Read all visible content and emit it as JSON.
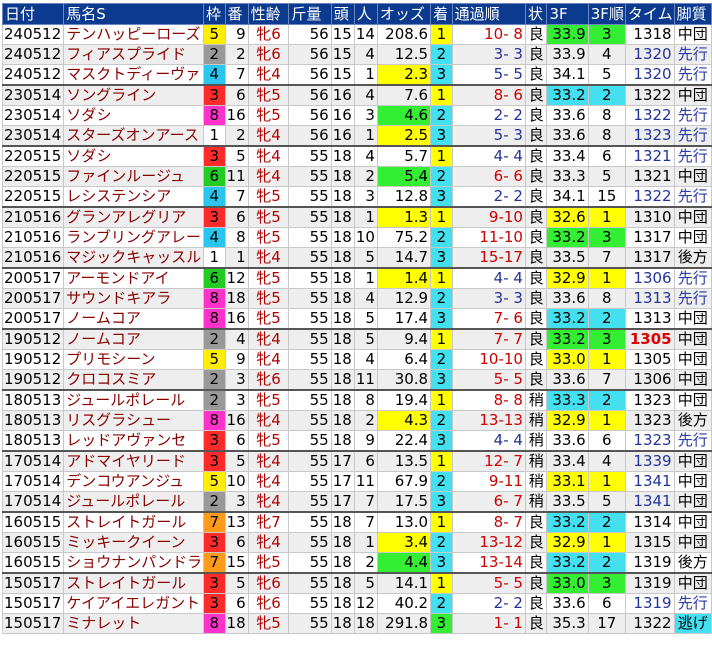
{
  "headers": [
    "日付",
    "馬名S",
    "枠",
    "番",
    "性齢",
    "斤量",
    "頭",
    "人",
    "オッズ",
    "着",
    "通過順",
    "状",
    "3F",
    "3F順",
    "タイム",
    "脚質"
  ],
  "rows": [
    {
      "date": "240512",
      "name": "テンハッピーローズ",
      "waku": "5",
      "ban": "9",
      "sexage": "牝6",
      "kin": "56",
      "tou": "15",
      "nin": "14",
      "odds": "208.6",
      "odds_hl": "",
      "chaku": "1",
      "chaku_hl": "yellow",
      "pass": "10- 8",
      "pass_color": "red",
      "cond": "良",
      "f3": "33.9",
      "f3_hl": "green",
      "f3r": "3",
      "f3r_hl": "green",
      "time": "1318",
      "time_style": "",
      "style": "中団",
      "style_hl": "",
      "sep": false
    },
    {
      "date": "240512",
      "name": "フィアスプライド",
      "waku": "2",
      "ban": "2",
      "sexage": "牝6",
      "kin": "56",
      "tou": "15",
      "nin": "4",
      "odds": "12.5",
      "odds_hl": "",
      "chaku": "2",
      "chaku_hl": "cyan",
      "pass": "3- 3",
      "pass_color": "blue",
      "cond": "良",
      "f3": "33.9",
      "f3_hl": "",
      "f3r": "4",
      "f3r_hl": "",
      "time": "1320",
      "time_style": "",
      "style": "先行",
      "style_hl": "lead",
      "sep": false
    },
    {
      "date": "240512",
      "name": "マスクトディーヴァ",
      "waku": "4",
      "ban": "7",
      "sexage": "牝4",
      "kin": "56",
      "tou": "15",
      "nin": "1",
      "odds": "2.3",
      "odds_hl": "yellow",
      "chaku": "3",
      "chaku_hl": "cyan",
      "pass": "5- 5",
      "pass_color": "blue",
      "cond": "良",
      "f3": "34.1",
      "f3_hl": "",
      "f3r": "5",
      "f3r_hl": "",
      "time": "1320",
      "time_style": "",
      "style": "先行",
      "style_hl": "lead",
      "sep": false
    },
    {
      "date": "230514",
      "name": "ソングライン",
      "waku": "3",
      "ban": "6",
      "sexage": "牝5",
      "kin": "56",
      "tou": "16",
      "nin": "4",
      "odds": "7.6",
      "odds_hl": "",
      "chaku": "1",
      "chaku_hl": "yellow",
      "pass": "8- 6",
      "pass_color": "red",
      "cond": "良",
      "f3": "33.2",
      "f3_hl": "cyan",
      "f3r": "2",
      "f3r_hl": "cyan",
      "time": "1322",
      "time_style": "",
      "style": "中団",
      "style_hl": "",
      "sep": true
    },
    {
      "date": "230514",
      "name": "ソダシ",
      "waku": "8",
      "ban": "16",
      "sexage": "牝5",
      "kin": "56",
      "tou": "16",
      "nin": "3",
      "odds": "4.6",
      "odds_hl": "green",
      "chaku": "2",
      "chaku_hl": "cyan",
      "pass": "2- 2",
      "pass_color": "blue",
      "cond": "良",
      "f3": "33.6",
      "f3_hl": "",
      "f3r": "8",
      "f3r_hl": "",
      "time": "1322",
      "time_style": "",
      "style": "先行",
      "style_hl": "lead",
      "sep": false
    },
    {
      "date": "230514",
      "name": "スターズオンアース",
      "waku": "1",
      "ban": "2",
      "sexage": "牝4",
      "kin": "56",
      "tou": "16",
      "nin": "1",
      "odds": "2.5",
      "odds_hl": "yellow",
      "chaku": "3",
      "chaku_hl": "cyan",
      "pass": "5- 3",
      "pass_color": "blue",
      "cond": "良",
      "f3": "33.6",
      "f3_hl": "",
      "f3r": "8",
      "f3r_hl": "",
      "time": "1323",
      "time_style": "",
      "style": "先行",
      "style_hl": "lead",
      "sep": false
    },
    {
      "date": "220515",
      "name": "ソダシ",
      "waku": "3",
      "ban": "5",
      "sexage": "牝4",
      "kin": "55",
      "tou": "18",
      "nin": "4",
      "odds": "5.7",
      "odds_hl": "",
      "chaku": "1",
      "chaku_hl": "yellow",
      "pass": "4- 4",
      "pass_color": "blue",
      "cond": "良",
      "f3": "33.4",
      "f3_hl": "",
      "f3r": "6",
      "f3r_hl": "",
      "time": "1321",
      "time_style": "",
      "style": "先行",
      "style_hl": "lead",
      "sep": true
    },
    {
      "date": "220515",
      "name": "ファインルージュ",
      "waku": "6",
      "ban": "11",
      "sexage": "牝4",
      "kin": "55",
      "tou": "18",
      "nin": "2",
      "odds": "5.4",
      "odds_hl": "green",
      "chaku": "2",
      "chaku_hl": "cyan",
      "pass": "6- 6",
      "pass_color": "red",
      "cond": "良",
      "f3": "33.3",
      "f3_hl": "",
      "f3r": "5",
      "f3r_hl": "",
      "time": "1321",
      "time_style": "",
      "style": "中団",
      "style_hl": "",
      "sep": false
    },
    {
      "date": "220515",
      "name": "レシステンシア",
      "waku": "4",
      "ban": "7",
      "sexage": "牝5",
      "kin": "55",
      "tou": "18",
      "nin": "3",
      "odds": "12.8",
      "odds_hl": "",
      "chaku": "3",
      "chaku_hl": "cyan",
      "pass": "2- 2",
      "pass_color": "blue",
      "cond": "良",
      "f3": "34.1",
      "f3_hl": "",
      "f3r": "15",
      "f3r_hl": "",
      "time": "1322",
      "time_style": "",
      "style": "先行",
      "style_hl": "lead",
      "sep": false
    },
    {
      "date": "210516",
      "name": "グランアレグリア",
      "waku": "3",
      "ban": "6",
      "sexage": "牝5",
      "kin": "55",
      "tou": "18",
      "nin": "1",
      "odds": "1.3",
      "odds_hl": "yellow",
      "chaku": "1",
      "chaku_hl": "yellow",
      "pass": "9-10",
      "pass_color": "red",
      "cond": "良",
      "f3": "32.6",
      "f3_hl": "yellow",
      "f3r": "1",
      "f3r_hl": "yellow",
      "time": "1310",
      "time_style": "",
      "style": "中団",
      "style_hl": "",
      "sep": true
    },
    {
      "date": "210516",
      "name": "ランブリングアレー",
      "waku": "4",
      "ban": "8",
      "sexage": "牝5",
      "kin": "55",
      "tou": "18",
      "nin": "10",
      "odds": "75.2",
      "odds_hl": "",
      "chaku": "2",
      "chaku_hl": "cyan",
      "pass": "11-10",
      "pass_color": "red",
      "cond": "良",
      "f3": "33.2",
      "f3_hl": "green",
      "f3r": "3",
      "f3r_hl": "green",
      "time": "1317",
      "time_style": "",
      "style": "中団",
      "style_hl": "",
      "sep": false
    },
    {
      "date": "210516",
      "name": "マジックキャッスル",
      "waku": "1",
      "ban": "1",
      "sexage": "牝4",
      "kin": "55",
      "tou": "18",
      "nin": "5",
      "odds": "14.7",
      "odds_hl": "",
      "chaku": "3",
      "chaku_hl": "cyan",
      "pass": "15-17",
      "pass_color": "red",
      "cond": "良",
      "f3": "33.5",
      "f3_hl": "",
      "f3r": "7",
      "f3r_hl": "",
      "time": "1317",
      "time_style": "",
      "style": "後方",
      "style_hl": "",
      "sep": false
    },
    {
      "date": "200517",
      "name": "アーモンドアイ",
      "waku": "6",
      "ban": "12",
      "sexage": "牝5",
      "kin": "55",
      "tou": "18",
      "nin": "1",
      "odds": "1.4",
      "odds_hl": "yellow",
      "chaku": "1",
      "chaku_hl": "yellow",
      "pass": "4- 4",
      "pass_color": "blue",
      "cond": "良",
      "f3": "32.9",
      "f3_hl": "yellow",
      "f3r": "1",
      "f3r_hl": "yellow",
      "time": "1306",
      "time_style": "",
      "style": "先行",
      "style_hl": "lead",
      "sep": true
    },
    {
      "date": "200517",
      "name": "サウンドキアラ",
      "waku": "8",
      "ban": "18",
      "sexage": "牝5",
      "kin": "55",
      "tou": "18",
      "nin": "4",
      "odds": "12.9",
      "odds_hl": "",
      "chaku": "2",
      "chaku_hl": "cyan",
      "pass": "3- 3",
      "pass_color": "blue",
      "cond": "良",
      "f3": "33.6",
      "f3_hl": "",
      "f3r": "8",
      "f3r_hl": "",
      "time": "1313",
      "time_style": "",
      "style": "先行",
      "style_hl": "lead",
      "sep": false
    },
    {
      "date": "200517",
      "name": "ノームコア",
      "waku": "8",
      "ban": "16",
      "sexage": "牝5",
      "kin": "55",
      "tou": "18",
      "nin": "5",
      "odds": "17.4",
      "odds_hl": "",
      "chaku": "3",
      "chaku_hl": "cyan",
      "pass": "7- 6",
      "pass_color": "red",
      "cond": "良",
      "f3": "33.2",
      "f3_hl": "cyan",
      "f3r": "2",
      "f3r_hl": "cyan",
      "time": "1313",
      "time_style": "",
      "style": "中団",
      "style_hl": "",
      "sep": false
    },
    {
      "date": "190512",
      "name": "ノームコア",
      "waku": "2",
      "ban": "4",
      "sexage": "牝4",
      "kin": "55",
      "tou": "18",
      "nin": "5",
      "odds": "9.4",
      "odds_hl": "",
      "chaku": "1",
      "chaku_hl": "yellow",
      "pass": "7- 7",
      "pass_color": "red",
      "cond": "良",
      "f3": "33.2",
      "f3_hl": "green",
      "f3r": "3",
      "f3r_hl": "green",
      "time": "1305",
      "time_style": "bold-red",
      "style": "中団",
      "style_hl": "",
      "sep": true
    },
    {
      "date": "190512",
      "name": "プリモシーン",
      "waku": "5",
      "ban": "9",
      "sexage": "牝4",
      "kin": "55",
      "tou": "18",
      "nin": "4",
      "odds": "6.4",
      "odds_hl": "",
      "chaku": "2",
      "chaku_hl": "cyan",
      "pass": "10-10",
      "pass_color": "red",
      "cond": "良",
      "f3": "33.0",
      "f3_hl": "yellow",
      "f3r": "1",
      "f3r_hl": "yellow",
      "time": "1305",
      "time_style": "",
      "style": "中団",
      "style_hl": "",
      "sep": false
    },
    {
      "date": "190512",
      "name": "クロコスミア",
      "waku": "2",
      "ban": "3",
      "sexage": "牝6",
      "kin": "55",
      "tou": "18",
      "nin": "11",
      "odds": "30.8",
      "odds_hl": "",
      "chaku": "3",
      "chaku_hl": "cyan",
      "pass": "5- 5",
      "pass_color": "red",
      "cond": "良",
      "f3": "33.6",
      "f3_hl": "",
      "f3r": "7",
      "f3r_hl": "",
      "time": "1306",
      "time_style": "",
      "style": "中団",
      "style_hl": "",
      "sep": false
    },
    {
      "date": "180513",
      "name": "ジュールポレール",
      "waku": "2",
      "ban": "3",
      "sexage": "牝5",
      "kin": "55",
      "tou": "18",
      "nin": "8",
      "odds": "19.4",
      "odds_hl": "",
      "chaku": "1",
      "chaku_hl": "yellow",
      "pass": "8- 8",
      "pass_color": "red",
      "cond": "稍",
      "f3": "33.3",
      "f3_hl": "cyan",
      "f3r": "2",
      "f3r_hl": "cyan",
      "time": "1323",
      "time_style": "",
      "style": "中団",
      "style_hl": "",
      "sep": true
    },
    {
      "date": "180513",
      "name": "リスグラシュー",
      "waku": "8",
      "ban": "16",
      "sexage": "牝4",
      "kin": "55",
      "tou": "18",
      "nin": "2",
      "odds": "4.3",
      "odds_hl": "yellow",
      "chaku": "2",
      "chaku_hl": "cyan",
      "pass": "13-13",
      "pass_color": "red",
      "cond": "稍",
      "f3": "32.9",
      "f3_hl": "yellow",
      "f3r": "1",
      "f3r_hl": "yellow",
      "time": "1323",
      "time_style": "",
      "style": "後方",
      "style_hl": "",
      "sep": false
    },
    {
      "date": "180513",
      "name": "レッドアヴァンセ",
      "waku": "3",
      "ban": "6",
      "sexage": "牝5",
      "kin": "55",
      "tou": "18",
      "nin": "9",
      "odds": "22.4",
      "odds_hl": "",
      "chaku": "3",
      "chaku_hl": "cyan",
      "pass": "4- 4",
      "pass_color": "blue",
      "cond": "稍",
      "f3": "33.6",
      "f3_hl": "",
      "f3r": "6",
      "f3r_hl": "",
      "time": "1323",
      "time_style": "",
      "style": "先行",
      "style_hl": "lead",
      "sep": false
    },
    {
      "date": "170514",
      "name": "アドマイヤリード",
      "waku": "3",
      "ban": "5",
      "sexage": "牝4",
      "kin": "55",
      "tou": "17",
      "nin": "6",
      "odds": "13.5",
      "odds_hl": "",
      "chaku": "1",
      "chaku_hl": "yellow",
      "pass": "12- 7",
      "pass_color": "red",
      "cond": "稍",
      "f3": "33.4",
      "f3_hl": "",
      "f3r": "4",
      "f3r_hl": "",
      "time": "1339",
      "time_style": "",
      "style": "中団",
      "style_hl": "",
      "sep": true
    },
    {
      "date": "170514",
      "name": "デンコウアンジュ",
      "waku": "5",
      "ban": "10",
      "sexage": "牝4",
      "kin": "55",
      "tou": "17",
      "nin": "11",
      "odds": "67.9",
      "odds_hl": "",
      "chaku": "2",
      "chaku_hl": "cyan",
      "pass": "9-11",
      "pass_color": "red",
      "cond": "稍",
      "f3": "33.1",
      "f3_hl": "yellow",
      "f3r": "1",
      "f3r_hl": "yellow",
      "time": "1341",
      "time_style": "",
      "style": "中団",
      "style_hl": "",
      "sep": false
    },
    {
      "date": "170514",
      "name": "ジュールポレール",
      "waku": "2",
      "ban": "3",
      "sexage": "牝4",
      "kin": "55",
      "tou": "17",
      "nin": "7",
      "odds": "17.5",
      "odds_hl": "",
      "chaku": "3",
      "chaku_hl": "cyan",
      "pass": "6- 7",
      "pass_color": "red",
      "cond": "稍",
      "f3": "33.5",
      "f3_hl": "",
      "f3r": "5",
      "f3r_hl": "",
      "time": "1341",
      "time_style": "",
      "style": "中団",
      "style_hl": "",
      "sep": false
    },
    {
      "date": "160515",
      "name": "ストレイトガール",
      "waku": "7",
      "ban": "13",
      "sexage": "牝7",
      "kin": "55",
      "tou": "18",
      "nin": "7",
      "odds": "13.0",
      "odds_hl": "",
      "chaku": "1",
      "chaku_hl": "yellow",
      "pass": "8- 7",
      "pass_color": "red",
      "cond": "良",
      "f3": "33.2",
      "f3_hl": "cyan",
      "f3r": "2",
      "f3r_hl": "cyan",
      "time": "1314",
      "time_style": "",
      "style": "中団",
      "style_hl": "",
      "sep": true
    },
    {
      "date": "160515",
      "name": "ミッキークイーン",
      "waku": "3",
      "ban": "6",
      "sexage": "牝4",
      "kin": "55",
      "tou": "18",
      "nin": "1",
      "odds": "3.4",
      "odds_hl": "yellow",
      "chaku": "2",
      "chaku_hl": "cyan",
      "pass": "13-12",
      "pass_color": "red",
      "cond": "良",
      "f3": "32.9",
      "f3_hl": "yellow",
      "f3r": "1",
      "f3r_hl": "yellow",
      "time": "1315",
      "time_style": "",
      "style": "中団",
      "style_hl": "",
      "sep": false
    },
    {
      "date": "160515",
      "name": "ショウナンパンドラ",
      "waku": "7",
      "ban": "15",
      "sexage": "牝5",
      "kin": "55",
      "tou": "18",
      "nin": "2",
      "odds": "4.4",
      "odds_hl": "green",
      "chaku": "3",
      "chaku_hl": "cyan",
      "pass": "13-14",
      "pass_color": "red",
      "cond": "良",
      "f3": "33.2",
      "f3_hl": "cyan",
      "f3r": "2",
      "f3r_hl": "cyan",
      "time": "1319",
      "time_style": "",
      "style": "後方",
      "style_hl": "",
      "sep": false
    },
    {
      "date": "150517",
      "name": "ストレイトガール",
      "waku": "3",
      "ban": "5",
      "sexage": "牝6",
      "kin": "55",
      "tou": "18",
      "nin": "5",
      "odds": "14.1",
      "odds_hl": "",
      "chaku": "1",
      "chaku_hl": "yellow",
      "pass": "5- 5",
      "pass_color": "red",
      "cond": "良",
      "f3": "33.0",
      "f3_hl": "green",
      "f3r": "3",
      "f3r_hl": "green",
      "time": "1319",
      "time_style": "",
      "style": "中団",
      "style_hl": "",
      "sep": true
    },
    {
      "date": "150517",
      "name": "ケイアイエレガント",
      "waku": "3",
      "ban": "6",
      "sexage": "牝6",
      "kin": "55",
      "tou": "18",
      "nin": "12",
      "odds": "40.2",
      "odds_hl": "",
      "chaku": "2",
      "chaku_hl": "cyan",
      "pass": "2- 2",
      "pass_color": "blue",
      "cond": "良",
      "f3": "33.6",
      "f3_hl": "",
      "f3r": "6",
      "f3r_hl": "",
      "time": "1319",
      "time_style": "",
      "style": "先行",
      "style_hl": "lead",
      "sep": false
    },
    {
      "date": "150517",
      "name": "ミナレット",
      "waku": "8",
      "ban": "18",
      "sexage": "牝5",
      "kin": "55",
      "tou": "18",
      "nin": "18",
      "odds": "291.8",
      "odds_hl": "",
      "chaku": "3",
      "chaku_hl": "green",
      "pass": "1- 1",
      "pass_color": "red",
      "cond": "良",
      "f3": "35.3",
      "f3_hl": "",
      "f3r": "17",
      "f3r_hl": "",
      "time": "1322",
      "time_style": "",
      "style": "逃げ",
      "style_hl": "escape",
      "sep": false
    }
  ],
  "colors": {
    "header_bg": "#0b3a8f",
    "header_text": "#ffffff",
    "yellow": "#ffff00",
    "green": "#33ee33",
    "cyan": "#44e0f0",
    "name_text": "#880000"
  }
}
